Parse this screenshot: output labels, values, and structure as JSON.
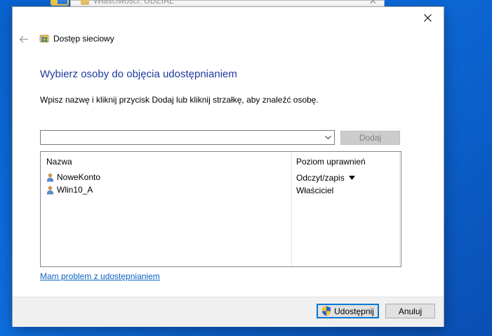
{
  "background_window": {
    "title": "Właściwości: UDZIAL",
    "close_glyph": "✕"
  },
  "dialog": {
    "nav_title": "Dostęp sieciowy",
    "heading": "Wybierz osoby do objęcia udostępnianiem",
    "instruction": "Wpisz nazwę i kliknij przycisk Dodaj lub kliknij strzałkę, aby znaleźć osobę.",
    "combo": {
      "value": ""
    },
    "add_button": "Dodaj",
    "list": {
      "columns": [
        "Nazwa",
        "Poziom uprawnień"
      ],
      "rows": [
        {
          "name": "NoweKonto",
          "permission": "Odczyt/zapis",
          "has_dropdown": true
        },
        {
          "name": "Wlin10_A",
          "permission": "Właściciel",
          "has_dropdown": false
        }
      ]
    },
    "help_link": "Mam problem z udostępnianiem",
    "buttons": {
      "share": "Udostępnij",
      "cancel": "Anuluj"
    }
  },
  "icons": {
    "close": "close-icon",
    "back": "back-arrow-icon",
    "network": "network-share-icon",
    "user": "user-icon",
    "shield": "uac-shield-icon",
    "chevron": "chevron-down-icon"
  },
  "colors": {
    "heading": "#1e3a9c",
    "link": "#0b63c4",
    "desktop": "#0a63d0",
    "primary_button_border": "#0078d7"
  }
}
